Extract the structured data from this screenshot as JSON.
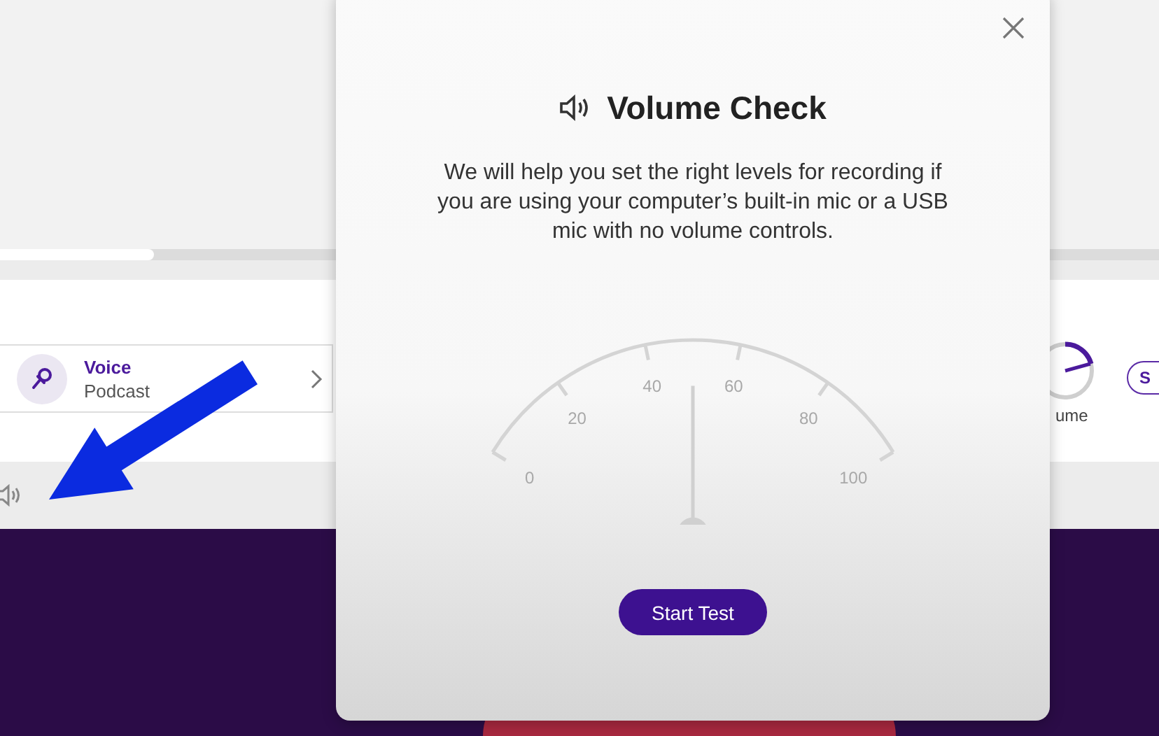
{
  "background": {
    "item": {
      "title": "Voice",
      "subtitle": "Podcast"
    },
    "knob_label": "ume",
    "pill_label": "S"
  },
  "modal": {
    "title": "Volume Check",
    "description": "We will help you set the right levels for recording if you are using your computer’s built-in mic or a USB mic with no volume controls.",
    "meter": {
      "labels": [
        "0",
        "20",
        "40",
        "60",
        "80",
        "100"
      ]
    },
    "button": "Start Test"
  }
}
